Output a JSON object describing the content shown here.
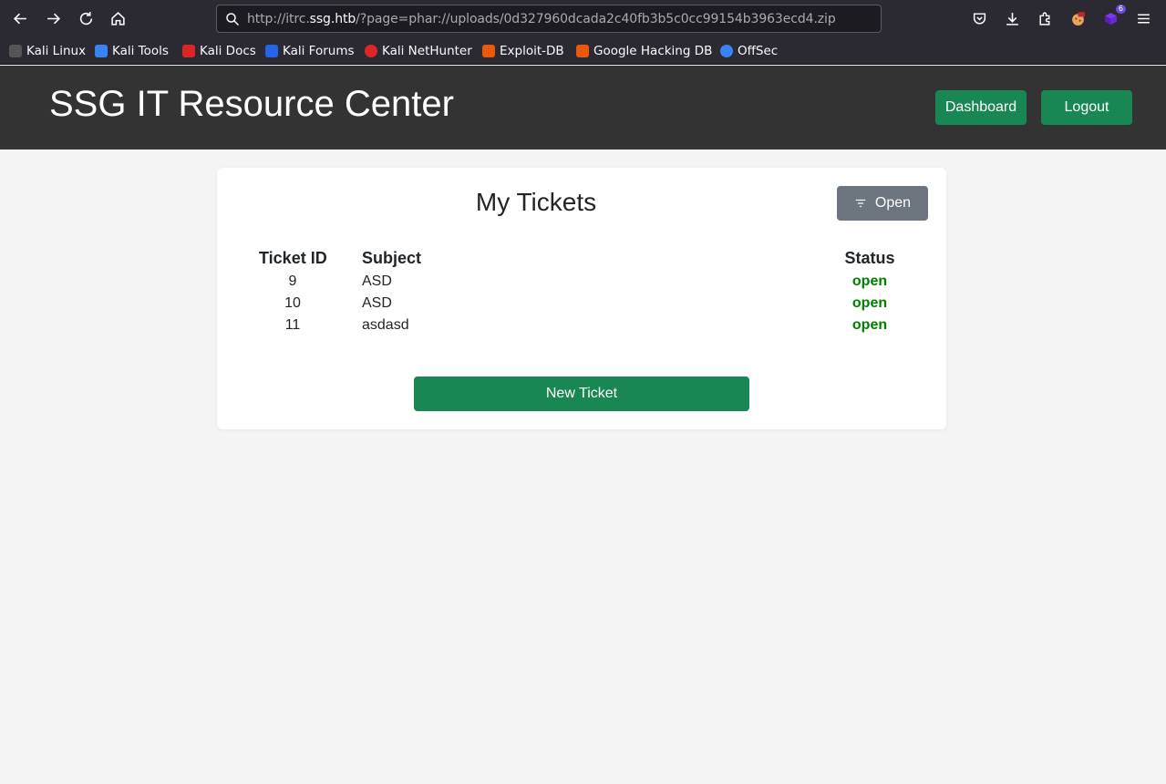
{
  "browser": {
    "url_prefix": "http://itrc.",
    "url_host": "ssg.htb",
    "url_path": "/?page=phar://uploads/0d327960dcada2c40fb3b5c0cc99154b3963ecd4.zip",
    "extension_badge": "6"
  },
  "bookmarks": [
    {
      "label": "Kali Linux",
      "icon": "kali-dragon-icon",
      "color": "#3a3a3a"
    },
    {
      "label": "Kali Tools",
      "icon": "kali-tools-icon",
      "color": "#3b82f6"
    },
    {
      "label": "Kali Docs",
      "icon": "kali-docs-icon",
      "color": "#dc2626"
    },
    {
      "label": "Kali Forums",
      "icon": "kali-forums-icon",
      "color": "#2563eb"
    },
    {
      "label": "Kali NetHunter",
      "icon": "nethunter-icon",
      "color": "#dc2626"
    },
    {
      "label": "Exploit-DB",
      "icon": "exploit-db-icon",
      "color": "#ea580c"
    },
    {
      "label": "Google Hacking DB",
      "icon": "ghdb-icon",
      "color": "#ea580c"
    },
    {
      "label": "OffSec",
      "icon": "offsec-icon",
      "color": "#3b82f6"
    }
  ],
  "header": {
    "title": "SSG IT Resource Center",
    "dashboard_label": "Dashboard",
    "logout_label": "Logout"
  },
  "tickets": {
    "title": "My Tickets",
    "filter_label": "Open",
    "columns": {
      "id": "Ticket ID",
      "subject": "Subject",
      "status": "Status"
    },
    "rows": [
      {
        "id": "9",
        "subject": "ASD",
        "status": "open"
      },
      {
        "id": "10",
        "subject": "ASD",
        "status": "open"
      },
      {
        "id": "11",
        "subject": "asdasd",
        "status": "open"
      }
    ],
    "new_ticket_label": "New Ticket"
  },
  "colors": {
    "primary_green": "#198754",
    "status_open": "#008000",
    "header_bg": "#333333",
    "secondary": "#6c757d"
  }
}
